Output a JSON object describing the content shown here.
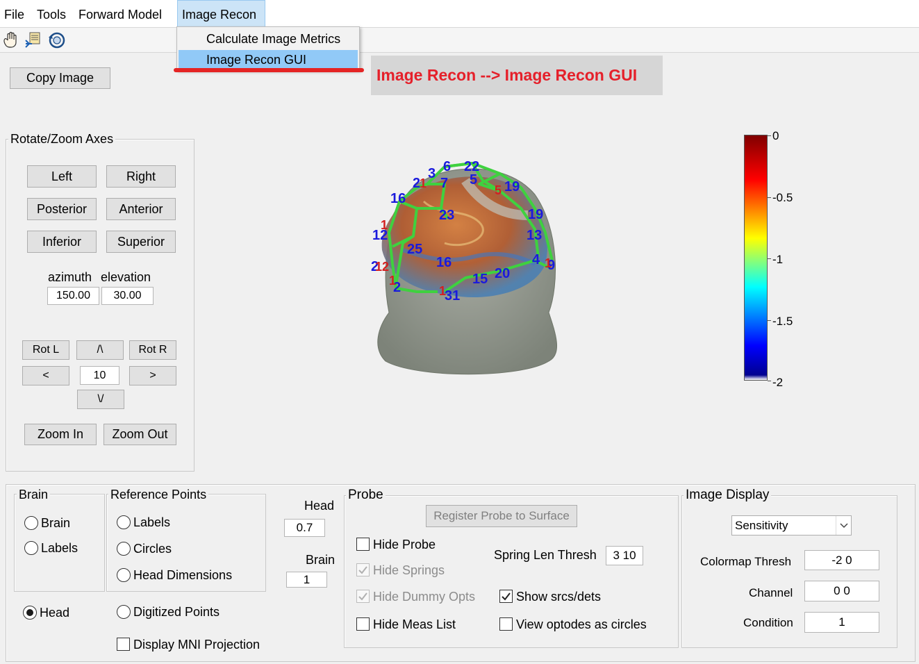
{
  "menu": {
    "file": "File",
    "tools": "Tools",
    "forward_model": "Forward Model",
    "image_recon": "Image Recon"
  },
  "dropdown": {
    "item1": "Calculate Image Metrics",
    "item2": "Image Recon GUI"
  },
  "annotation": "Image Recon --> Image Recon GUI",
  "copy_image": "Copy Image",
  "rotate_panel": {
    "title": "Rotate/Zoom Axes",
    "left": "Left",
    "right": "Right",
    "posterior": "Posterior",
    "anterior": "Anterior",
    "inferior": "Inferior",
    "superior": "Superior",
    "azimuth_label": "azimuth",
    "elevation_label": "elevation",
    "azimuth_value": "150.00",
    "elevation_value": "30.00",
    "rot_l": "Rot L",
    "up": "/\\",
    "rot_r": "Rot R",
    "prev": "<",
    "step": "10",
    "next": ">",
    "down": "\\/",
    "zoom_in": "Zoom In",
    "zoom_out": "Zoom Out"
  },
  "colorbar": {
    "ticks": [
      "0",
      "-0.5",
      "-1",
      "-1.5",
      "-2"
    ]
  },
  "brain_panel": {
    "title": "Brain",
    "brain": "Brain",
    "labels": "Labels"
  },
  "head_radio": "Head",
  "ref_panel": {
    "title": "Reference Points",
    "labels": "Labels",
    "circles": "Circles",
    "head_dimensions": "Head Dimensions"
  },
  "digitized_points": "Digitized Points",
  "display_mni": "Display MNI Projection",
  "head_label": "Head",
  "head_value": "0.7",
  "brain_label": "Brain",
  "brain_value": "1",
  "probe": {
    "title": "Probe",
    "register": "Register Probe to Surface",
    "hide_probe": "Hide Probe",
    "hide_springs": "Hide Springs",
    "hide_dummy": "Hide Dummy Opts",
    "hide_meas": "Hide Meas List",
    "spring_label": "Spring Len Thresh",
    "spring_value": "3  10",
    "show_srcs": "Show srcs/dets",
    "view_optodes": "View optodes as circles"
  },
  "image_display": {
    "title": "Image Display",
    "select_value": "Sensitivity",
    "colormap_label": "Colormap Thresh",
    "colormap_value": "-2 0",
    "channel_label": "Channel",
    "channel_value": "0 0",
    "condition_label": "Condition",
    "condition_value": "1"
  },
  "probe_labels": [
    "6",
    "22",
    "3",
    "2",
    "7",
    "5",
    "19",
    "2",
    "9",
    "15",
    "13",
    "9",
    "23",
    "12",
    "25",
    "16",
    "4",
    "9",
    "21",
    "13",
    "1",
    "31",
    "20",
    "15",
    "2",
    "2"
  ]
}
